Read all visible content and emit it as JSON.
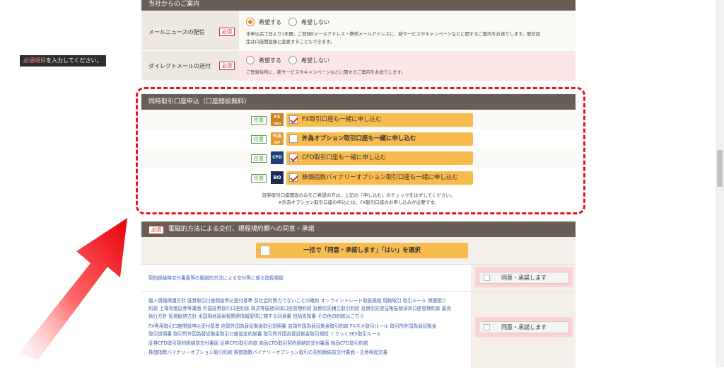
{
  "required_notice": {
    "prefix": "必須項目",
    "suffix": "を入力してください。"
  },
  "contact_section": {
    "title": "当社からのご案内",
    "rows": [
      {
        "label": "メールニュースの配信",
        "badge": "必須",
        "options": [
          "希望する",
          "希望しない"
        ],
        "selected": "希望する",
        "note1": "本申込完了日より1年間、ご登録Eメールアドレス・携帯メールアドレスに、新サービスやキャンペーンなどに関するご案内をお送りします。配信設",
        "note2": "定は口座開設後に変更することもできます。"
      },
      {
        "label": "ダイレクトメールの送付",
        "badge": "必須",
        "options": [
          "希望する",
          "希望しない"
        ],
        "selected": "",
        "note1": "ご登録住所に、新サービスやキャンペーンなどに関するご案内をお送りします。"
      }
    ]
  },
  "simultaneous": {
    "title": "同時取引口座申込（口座開設無料）",
    "optional_label": "任意",
    "items": [
      {
        "icon_text": "FX",
        "icon_sub": "neo",
        "label": "FX取引口座も一緒に申し込む",
        "checked": true,
        "icon_color": "#c9861c"
      },
      {
        "icon_text": "外為",
        "icon_sub": "OP",
        "label": "外為オプション取引口座も一緒に申し込む",
        "checked": false,
        "icon_color": "#e59a2c"
      },
      {
        "icon_text": "CFD",
        "icon_sub": "",
        "label": "CFD取引口座も一緒に申し込む",
        "checked": true,
        "icon_color": "#1e3f7a"
      },
      {
        "icon_text": "BO",
        "icon_sub": "",
        "label": "株価指数バイナリーオプション取引口座も一緒に申し込む",
        "checked": true,
        "icon_color": "#1a2b55"
      }
    ],
    "note1": "証券取引口座開設のみをご希望の方は、上記の「申し込む」のチェックをはずしてください。",
    "note2": "※外為オプション取引口座の申込には、FX取引口座のお申し込みが必要です。"
  },
  "agreement": {
    "badge": "必須",
    "title": "電磁的方法による交付、規程規約類への同意・承諾",
    "bulk_button": "一括で「同意・承諾します」「はい」を選択",
    "row1_link": "契約締結時交付書面等の電磁的方法による交付等に係る取扱規程",
    "agree_label": "同意・承諾します",
    "group2_lines": [
      "個人情報保護方針  証券取引口座開設申込受付基準  反社会的勢力でないことの確約  オンライントレード取扱規程  現物取引  取引ルール  保護預り",
      "約款  上場有価証券等書面  外国証券取引口座約款  株式等振替決済口座管理約款  投資信託積立取引約款  投資信託受益権振替決済口座管理約款  最良",
      "執行方針  投資勧誘方針  米国現地源泉税関連情報提供に関する同意書  包括告知書  その他の約款はこちら"
    ],
    "group3_lines": [
      "FX専用取引口座開設申込受付基準    店頭外国為替証拠金取引説明書    店頭外国為替証拠金取引約款    FXネオ取引ルール    取引所外国為替証拠金",
      "取引説明書    取引所外国為替証拠金取引口座設定約諾書    取引所外国為替証拠金取引規程    くりっく365取引ルール",
      "証券CFD取引契約締結前交付書面  証券CFD取引約款  商品CFD取引契約締結前交付書面  商品CFD取引約款",
      "株価指数バイナリーオプション取引約款  株価指数バイナリーオプション取引の契約締結前交付書面・注意喚起文書"
    ]
  }
}
